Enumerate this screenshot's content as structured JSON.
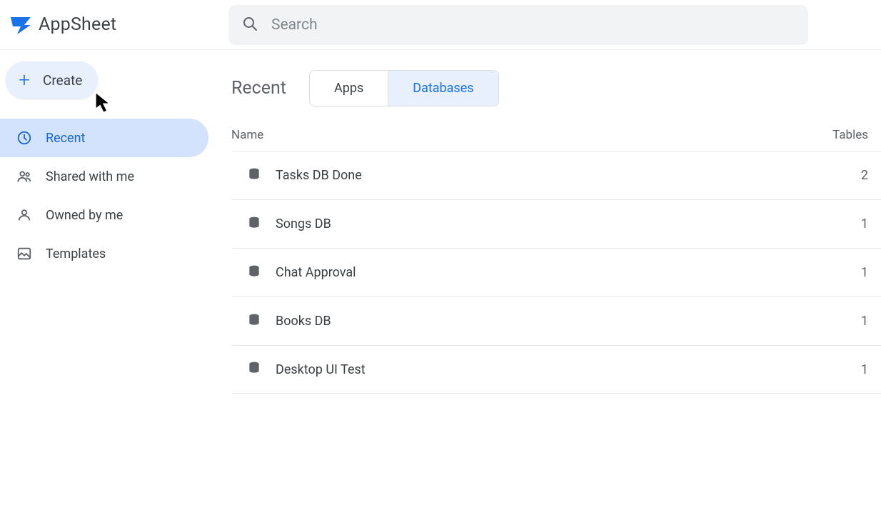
{
  "brand": {
    "name": "AppSheet"
  },
  "search": {
    "placeholder": "Search",
    "value": ""
  },
  "sidebar": {
    "create_label": "Create",
    "items": [
      {
        "label": "Recent",
        "icon": "clock-icon",
        "active": true
      },
      {
        "label": "Shared with me",
        "icon": "people-icon",
        "active": false
      },
      {
        "label": "Owned by me",
        "icon": "person-icon",
        "active": false
      },
      {
        "label": "Templates",
        "icon": "image-icon",
        "active": false
      }
    ]
  },
  "main": {
    "section_title": "Recent",
    "tabs": [
      {
        "label": "Apps",
        "selected": false
      },
      {
        "label": "Databases",
        "selected": true
      }
    ],
    "columns": {
      "name": "Name",
      "tables": "Tables"
    },
    "rows": [
      {
        "name": "Tasks DB Done",
        "tables": 2
      },
      {
        "name": "Songs DB",
        "tables": 1
      },
      {
        "name": "Chat Approval",
        "tables": 1
      },
      {
        "name": "Books DB",
        "tables": 1
      },
      {
        "name": "Desktop UI Test",
        "tables": 1
      }
    ]
  },
  "colors": {
    "accent": "#1a73e8",
    "surface": "#f1f3f4",
    "selected_bg": "#d3e3fd"
  }
}
